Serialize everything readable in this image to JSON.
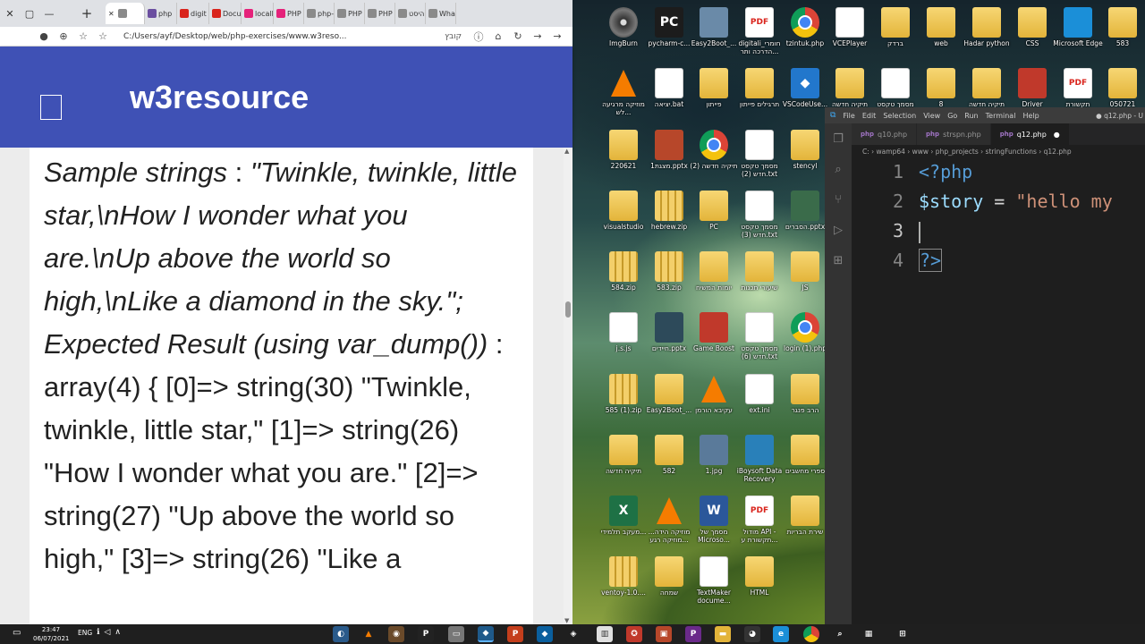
{
  "browser": {
    "window_controls": [
      "✕",
      "▢",
      "—"
    ],
    "tabs": [
      {
        "label": "w3r",
        "color": "#8a8a8a",
        "active": true
      },
      {
        "label": "php",
        "color": "#6b4fa0"
      },
      {
        "label": "digit",
        "color": "#d9241c"
      },
      {
        "label": "Docu",
        "color": "#d9241c"
      },
      {
        "label": "localh",
        "color": "#e5227a"
      },
      {
        "label": "PHP",
        "color": "#e5227a"
      },
      {
        "label": "php-",
        "color": "#8a8a8a"
      },
      {
        "label": "PHP",
        "color": "#8a8a8a"
      },
      {
        "label": "PHP",
        "color": "#8a8a8a"
      },
      {
        "label": "היסט",
        "color": "#8a8a8a"
      },
      {
        "label": "What",
        "color": "#8a8a8a"
      }
    ],
    "tab_close": "✕",
    "tab_add": "+",
    "url": "C:/Users/ayf/Desktop/web/php-exercises/www.w3reso...",
    "url_badge": "קובץ"
  },
  "site": {
    "title": "w3resource"
  },
  "article": {
    "p1_label": "Sample strings",
    "p1_rest": " : ",
    "p1_italic": "\"Twinkle, twinkle, little star,\\nHow I wonder what you are.\\nUp above the world so high,\\nLike a diamond in the sky.\"; Expected Result (using var_dump())",
    "p2": " : array(4) { [0]=> string(30) \"Twinkle, twinkle, little star,\" [1]=> string(26) \"How I wonder what you are.\" [2]=> string(27) \"Up above the world so high,\" [3]=> string(26) \"Like a"
  },
  "desktop_icons": [
    {
      "label": "ImgBurn",
      "kind": "disc",
      "color": "#3a3a3a"
    },
    {
      "label": "pycharm-c...",
      "kind": "app",
      "color": "#1c1c1c",
      "text": "PC"
    },
    {
      "label": "Easy2Boot_...",
      "kind": "app",
      "color": "#6a8aa8"
    },
    {
      "label": "digitali_חומרי הדרכה ותר...",
      "kind": "pdf"
    },
    {
      "label": "tzintuk.php",
      "kind": "chrome"
    },
    {
      "label": "VCEPlayer",
      "kind": "doc"
    },
    {
      "label": "ברדק",
      "kind": "folder"
    },
    {
      "label": "web",
      "kind": "folder"
    },
    {
      "label": "Hadar python",
      "kind": "folder"
    },
    {
      "label": "CSS",
      "kind": "folder"
    },
    {
      "label": "Microsoft Edge",
      "kind": "app",
      "color": "#1b8fd8"
    },
    {
      "label": "583",
      "kind": "folder"
    },
    {
      "label": "מוזיקה מרגיעה לש...",
      "kind": "vlc"
    },
    {
      "label": "יציאה.bat",
      "kind": "doc"
    },
    {
      "label": "פייתון",
      "kind": "folder"
    },
    {
      "label": "תרגילים פייתון",
      "kind": "folder"
    },
    {
      "label": "VSCodeUse...",
      "kind": "app",
      "color": "#2277cc",
      "text": "◆"
    },
    {
      "label": "תיקיה חדשה",
      "kind": "folder"
    },
    {
      "label": "מסמך טקסט",
      "kind": "doc"
    },
    {
      "label": "8",
      "kind": "folder"
    },
    {
      "label": "תיקיה חדשה",
      "kind": "folder"
    },
    {
      "label": "Driver",
      "kind": "app",
      "color": "#c0392b"
    },
    {
      "label": "תקשורת",
      "kind": "pdf"
    },
    {
      "label": "050721",
      "kind": "folder"
    },
    {
      "label": "220621",
      "kind": "folder"
    },
    {
      "label": "מצגת1.pptx",
      "kind": "app",
      "color": "#b7472a"
    },
    {
      "label": "תיקיה חדשה (2)",
      "kind": "chrome"
    },
    {
      "label": "מסמך טקסט חדש (2).txt",
      "kind": "doc"
    },
    {
      "label": "stencyl",
      "kind": "folder"
    },
    {
      "label": "visualstudio",
      "kind": "folder"
    },
    {
      "label": "hebrew.zip",
      "kind": "zip"
    },
    {
      "label": "PC",
      "kind": "folder"
    },
    {
      "label": "מסמך טקסט חדש (3).txt",
      "kind": "doc"
    },
    {
      "label": "הסברים.pptx",
      "kind": "app",
      "color": "#3a6b4a"
    },
    {
      "label": "584.zip",
      "kind": "zip"
    },
    {
      "label": "583.zip",
      "kind": "zip"
    },
    {
      "label": "יומות המשיח",
      "kind": "folder"
    },
    {
      "label": "שיעורי תכנות",
      "kind": "folder"
    },
    {
      "label": "JS",
      "kind": "folder"
    },
    {
      "label": "j.s.js",
      "kind": "doc"
    },
    {
      "label": "חיידים.pptx",
      "kind": "app",
      "color": "#2d4a5a"
    },
    {
      "label": "Game Boost",
      "kind": "app",
      "color": "#c0392b"
    },
    {
      "label": "מסמך טקסט חדש (6).txt",
      "kind": "doc"
    },
    {
      "label": "login (1).php",
      "kind": "chrome"
    },
    {
      "label": "585 (1).zip",
      "kind": "zip"
    },
    {
      "label": "Easy2Boot_...",
      "kind": "folder"
    },
    {
      "label": "עקיבא הורמן",
      "kind": "vlc"
    },
    {
      "label": "ext.ini",
      "kind": "doc"
    },
    {
      "label": "הרב פנגר",
      "kind": "folder"
    },
    {
      "label": "תיקיה חדשה",
      "kind": "folder"
    },
    {
      "label": "582",
      "kind": "folder"
    },
    {
      "label": "1.jpg",
      "kind": "app",
      "color": "#5a7a9a"
    },
    {
      "label": "iBoysoft Data Recovery",
      "kind": "app",
      "color": "#2980b9"
    },
    {
      "label": "ספרי מחשבים",
      "kind": "folder"
    },
    {
      "label": "מעקב תלמידי...",
      "kind": "app",
      "color": "#1e7145",
      "text": "X"
    },
    {
      "label": "מוזיקה הידה... מוזיקה רגע...",
      "kind": "vlc"
    },
    {
      "label": "מסמך של Microso...",
      "kind": "app",
      "color": "#2b579a",
      "text": "W"
    },
    {
      "label": "מודול API - תקשורת ע...",
      "kind": "pdf"
    },
    {
      "label": "שירת הבריות",
      "kind": "folder"
    },
    {
      "label": "ventoy-1.0....",
      "kind": "zip"
    },
    {
      "label": "שמחה",
      "kind": "folder"
    },
    {
      "label": "TextMaker docume...",
      "kind": "doc"
    },
    {
      "label": "HTML",
      "kind": "folder"
    }
  ],
  "vscode": {
    "menu": [
      "File",
      "Edit",
      "Selection",
      "View",
      "Go",
      "Run",
      "Terminal",
      "Help"
    ],
    "window_title": "● q12.php - U",
    "tabs": [
      {
        "label": "q10.php",
        "active": false
      },
      {
        "label": "strspn.php",
        "active": false
      },
      {
        "label": "q12.php",
        "active": true,
        "dirty": "●"
      }
    ],
    "tab_icon": "php",
    "breadcrumb": "C: › wamp64 › www › php_projects › stringFunctions › q12.php",
    "lines": [
      {
        "num": "1",
        "open": "<?php"
      },
      {
        "num": "2",
        "var": "$story",
        "op": " = ",
        "str": "\"hello my"
      },
      {
        "num": "3"
      },
      {
        "num": "4",
        "close": "?>"
      }
    ]
  },
  "taskbar": {
    "time": "23:47",
    "date": "06/07/2021",
    "lang": "ENG",
    "notif_icon": "▭",
    "sys_icons": "ℹ◁∧"
  }
}
